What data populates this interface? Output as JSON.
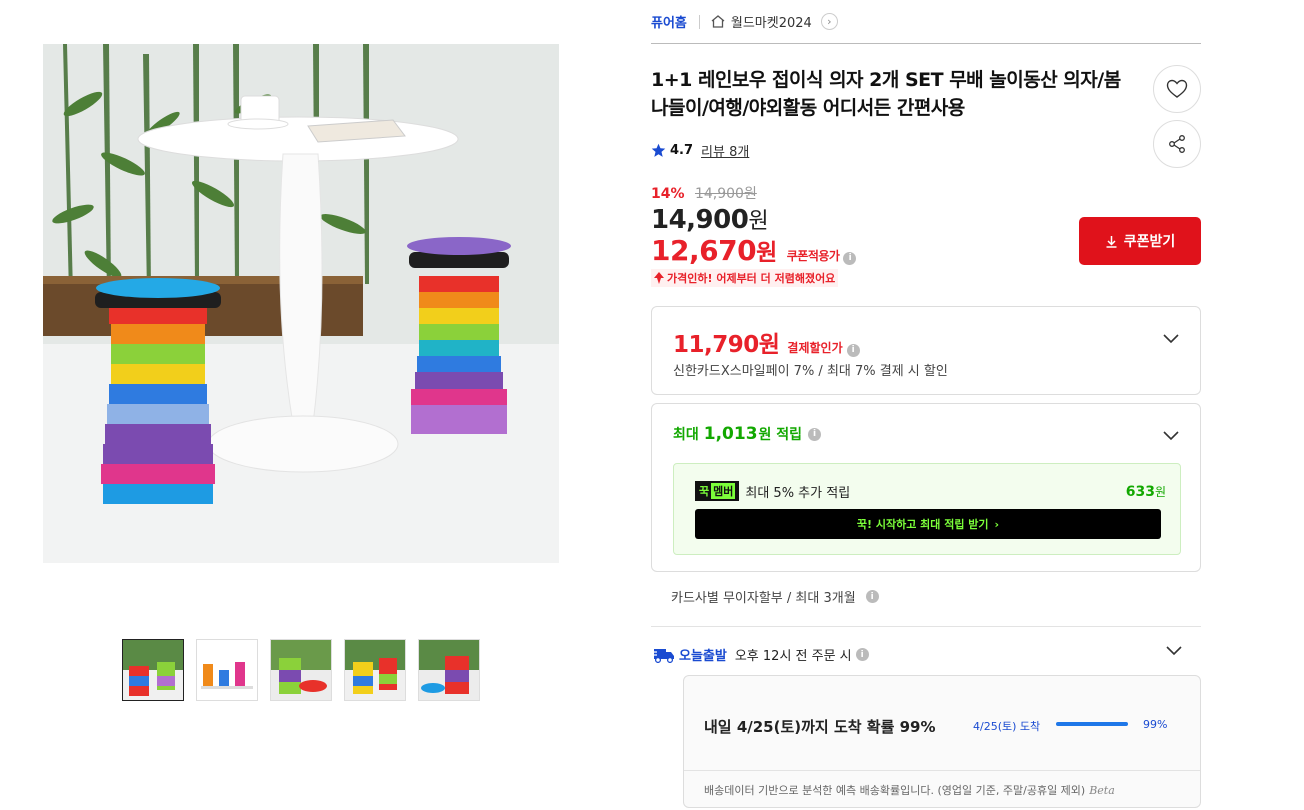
{
  "breadcrumb": {
    "home": "퓨어홈",
    "store": "월드마켓2024"
  },
  "product": {
    "title": "1+1 레인보우 접이식 의자 2개 SET 무배 놀이동산 의자/봄 나들이/여행/야외활동 어디서든 간편사용",
    "rating": "4.7",
    "review_label": "리뷰 8개"
  },
  "pricing": {
    "discount_rate": "14%",
    "original_price": "14,900원",
    "price_value": "14,900",
    "price_unit": "원",
    "coupon_price_value": "12,670",
    "coupon_price_unit": "원",
    "coupon_price_label": "쿠폰적용가",
    "price_drop_text": "가격인하! 어제부터 더 저렴해졌어요",
    "coupon_button": "쿠폰받기"
  },
  "payment": {
    "price": "11,790원",
    "label": "결제할인가",
    "desc": "신한카드X스마일페이 7% / 최대 7% 결제 시 할인"
  },
  "reward": {
    "prefix": "최대",
    "amount": "1,013",
    "suffix": "원 적립",
    "member_tag_1": "꾹",
    "member_tag_2": "멤버",
    "member_text": "최대 5% 추가 적립",
    "member_amount": "633",
    "member_amount_unit": "원",
    "member_button": "꾹! 시작하고 최대 적립 받기"
  },
  "installment": "카드사별 무이자할부 / 최대 3개월",
  "shipping": {
    "badge": "오늘출발",
    "text": "오후 12시 전 주문 시",
    "delivery_title": "내일 4/25(토)까지 도착 확률 99%",
    "delivery_date": "4/25(토) 도착",
    "delivery_percent": "99%",
    "delivery_probability": 0.99,
    "note": "배송데이터 기반으로 분석한 예측 배송확률입니다. (영업일 기준, 주말/공휴일 제외)",
    "beta": "Beta"
  },
  "colors": {
    "accent_red": "#e0121b",
    "accent_blue": "#1a4bd1",
    "accent_green": "#12a800"
  }
}
